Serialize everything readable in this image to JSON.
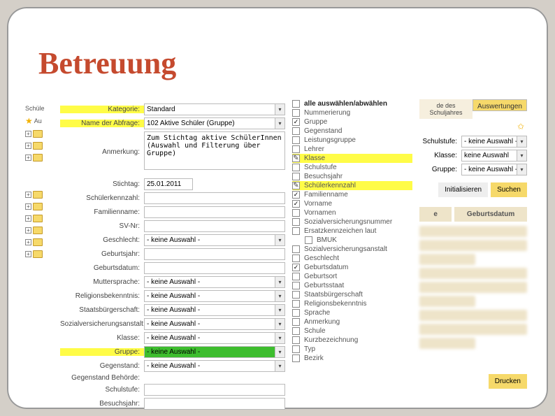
{
  "page": {
    "title": "Betreuung"
  },
  "filter": {
    "kategorie_label": "Kategorie:",
    "kategorie_value": "Standard",
    "name_abfrage_label": "Name der Abfrage:",
    "name_abfrage_value": "102 Aktive Schüler (Gruppe)",
    "anmerkung_label": "Anmerkung:",
    "anmerkung_value": "Zum Stichtag aktive SchülerInnen (Auswahl und Filterung über Gruppe)",
    "stichtag_label": "Stichtag:",
    "stichtag_value": "25.01.2011",
    "schuelerkennzahl_label": "Schülerkennzahl:",
    "familienname_label": "Familienname:",
    "svnr_label": "SV-Nr:",
    "geschlecht_label": "Geschlecht:",
    "geburtsjahr_label": "Geburtsjahr:",
    "geburtsdatum_label": "Geburtsdatum:",
    "muttersprache_label": "Muttersprache:",
    "religionsbekenntnis_label": "Religionsbekenntnis:",
    "staatsbuergerschaft_label": "Staatsbürgerschaft:",
    "sva_label": "Sozialversicherungsanstalt:",
    "klasse_label": "Klasse:",
    "gruppe_label": "Gruppe:",
    "gegenstand_label": "Gegenstand:",
    "gegenstand_behoerde_label": "Gegenstand Behörde:",
    "schulstufe_label": "Schulstufe:",
    "besuchsjahr_label": "Besuchsjahr:",
    "keine_auswahl": "- keine Auswahl -"
  },
  "checks": {
    "header": "alle auswählen/abwählen",
    "items": [
      {
        "label": "Nummerierung",
        "checked": false,
        "hl": false
      },
      {
        "label": "Gruppe",
        "checked": true,
        "hl": false
      },
      {
        "label": "Gegenstand",
        "checked": false,
        "hl": false
      },
      {
        "label": "Leistungsgruppe",
        "checked": false,
        "hl": false
      },
      {
        "label": "Lehrer",
        "checked": false,
        "hl": false
      },
      {
        "label": "Klasse",
        "checked": false,
        "hl": true,
        "pen": true
      },
      {
        "label": "Schulstufe",
        "checked": false,
        "hl": false
      },
      {
        "label": "Besuchsjahr",
        "checked": false,
        "hl": false
      },
      {
        "label": "Schülerkennzahl",
        "checked": false,
        "hl": true,
        "pen": true
      },
      {
        "label": "Familienname",
        "checked": true,
        "hl": false
      },
      {
        "label": "Vorname",
        "checked": true,
        "hl": false
      },
      {
        "label": "Vornamen",
        "checked": false,
        "hl": false
      },
      {
        "label": "Sozialversicherungsnummer",
        "checked": false,
        "hl": false
      },
      {
        "label": "Ersatzkennzeichen laut",
        "checked": false,
        "hl": false
      },
      {
        "label": "BMUK",
        "checked": false,
        "hl": false,
        "indent": true
      },
      {
        "label": "Sozialversicherungsanstalt",
        "checked": false,
        "hl": false
      },
      {
        "label": "Geschlecht",
        "checked": false,
        "hl": false
      },
      {
        "label": "Geburtsdatum",
        "checked": true,
        "hl": false
      },
      {
        "label": "Geburtsort",
        "checked": false,
        "hl": false
      },
      {
        "label": "Geburtsstaat",
        "checked": false,
        "hl": false
      },
      {
        "label": "Staatsbürgerschaft",
        "checked": false,
        "hl": false
      },
      {
        "label": "Religionsbekenntnis",
        "checked": false,
        "hl": false
      },
      {
        "label": "Sprache",
        "checked": false,
        "hl": false
      },
      {
        "label": "Anmerkung",
        "checked": false,
        "hl": false
      },
      {
        "label": "Schule",
        "checked": false,
        "hl": false
      },
      {
        "label": "Kurzbezeichnung",
        "checked": false,
        "hl": false
      },
      {
        "label": "Typ",
        "checked": false,
        "hl": false
      },
      {
        "label": "Bezirk",
        "checked": false,
        "hl": false
      }
    ]
  },
  "right": {
    "tab1": "de des Schuljahres",
    "tab2": "Auswertungen",
    "filter": {
      "schulstufe_label": "Schulstufe:",
      "klasse_label": "Klasse:",
      "gruppe_label": "Gruppe:",
      "keine_auswahl": "- keine Auswahl -",
      "keine_auswahl2": "keine Auswahl"
    },
    "btn_init": "Initialisieren",
    "btn_search": "Suchen",
    "th_e": "e",
    "th_geb": "Geburtsdatum",
    "btn_print": "Drucken"
  },
  "tree_label": "Schüle",
  "tree_label2": "Au"
}
